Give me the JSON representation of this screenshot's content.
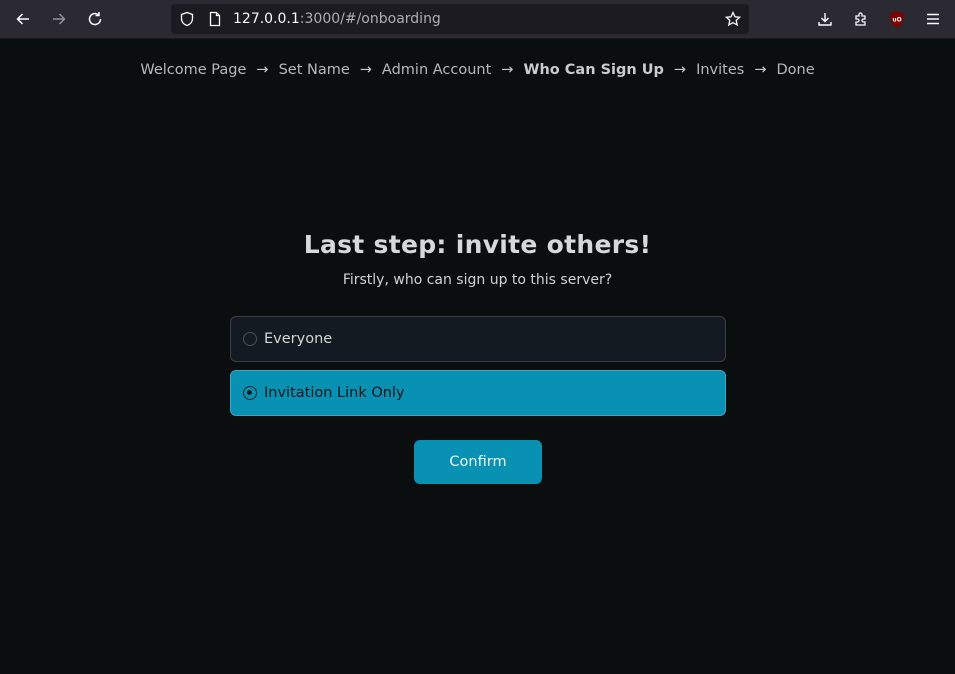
{
  "browser": {
    "url_host": "127.0.0.1",
    "url_rest": ":3000/#/onboarding"
  },
  "breadcrumb": {
    "steps": [
      "Welcome Page",
      "Set Name",
      "Admin Account",
      "Who Can Sign Up",
      "Invites",
      "Done"
    ],
    "separator": "→",
    "current_index": 3
  },
  "main": {
    "title": "Last step: invite others!",
    "subtitle": "Firstly, who can sign up to this server?",
    "options": [
      {
        "label": "Everyone",
        "selected": false
      },
      {
        "label": "Invitation Link Only",
        "selected": true
      }
    ],
    "confirm_label": "Confirm"
  },
  "colors": {
    "accent": "#0891b2",
    "background": "#0b0e0f",
    "option_bg": "#141a22"
  }
}
